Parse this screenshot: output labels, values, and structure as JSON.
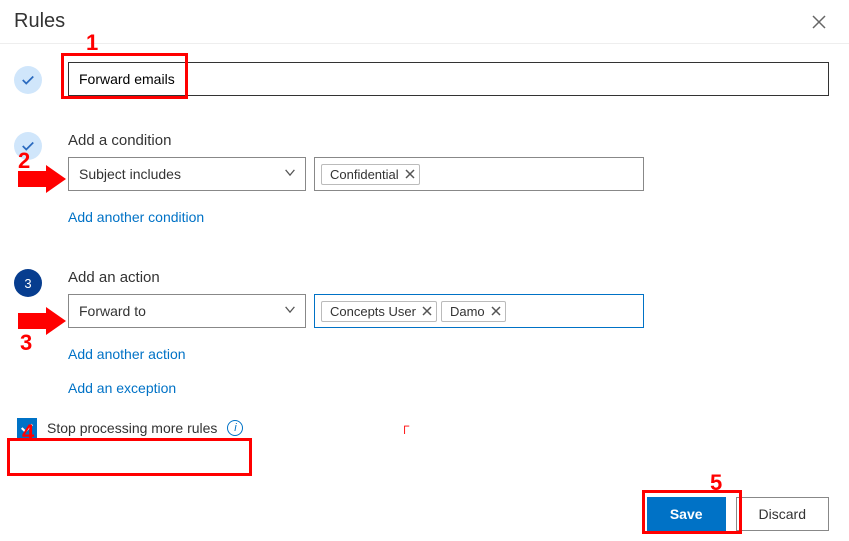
{
  "header": {
    "title": "Rules"
  },
  "ruleName": {
    "value": "Forward emails"
  },
  "condition": {
    "title": "Add a condition",
    "selectLabel": "Subject includes",
    "token": "Confidential",
    "addAnother": "Add another condition"
  },
  "action": {
    "stepNum": "3",
    "title": "Add an action",
    "selectLabel": "Forward to",
    "tokens": [
      "Concepts User",
      "Damo"
    ],
    "addAnother": "Add another action",
    "addException": "Add an exception"
  },
  "stopProcessing": {
    "label": "Stop processing more rules"
  },
  "buttons": {
    "save": "Save",
    "discard": "Discard"
  },
  "annotations": {
    "n1": "1",
    "n2": "2",
    "n3": "3",
    "n4": "4",
    "n5": "5"
  }
}
